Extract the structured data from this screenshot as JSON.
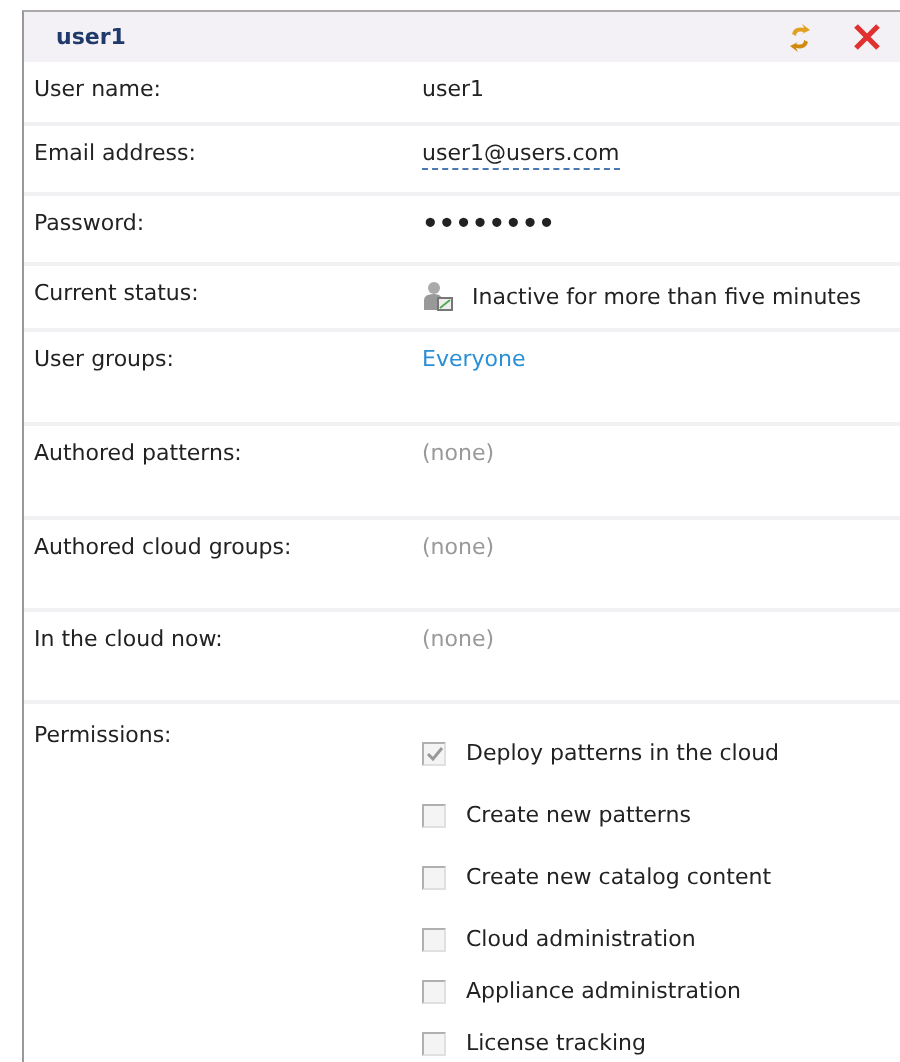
{
  "header": {
    "title": "user1"
  },
  "rows": [
    {
      "kind": "text",
      "label": "User name:",
      "value": "user1"
    },
    {
      "kind": "email",
      "label": "Email address:",
      "value": "user1@users.com"
    },
    {
      "kind": "password",
      "label": "Password:",
      "value": "••••••••"
    },
    {
      "kind": "status",
      "label": "Current status:",
      "value": "Inactive for more than five minutes"
    },
    {
      "kind": "link",
      "label": "User groups:",
      "value": "Everyone"
    },
    {
      "kind": "none",
      "label": "Authored patterns:",
      "value": "(none)"
    },
    {
      "kind": "none",
      "label": "Authored cloud groups:",
      "value": "(none)"
    },
    {
      "kind": "none",
      "label": "In the cloud now:",
      "value": "(none)"
    }
  ],
  "permissions": {
    "label": "Permissions:",
    "items": [
      {
        "label": "Deploy patterns in the cloud",
        "checked": true
      },
      {
        "label": "Create new patterns",
        "checked": false
      },
      {
        "label": "Create new catalog content",
        "checked": false
      },
      {
        "label": "Cloud administration",
        "checked": false
      },
      {
        "label": "Appliance administration",
        "checked": false
      },
      {
        "label": "License tracking",
        "checked": false
      }
    ]
  }
}
